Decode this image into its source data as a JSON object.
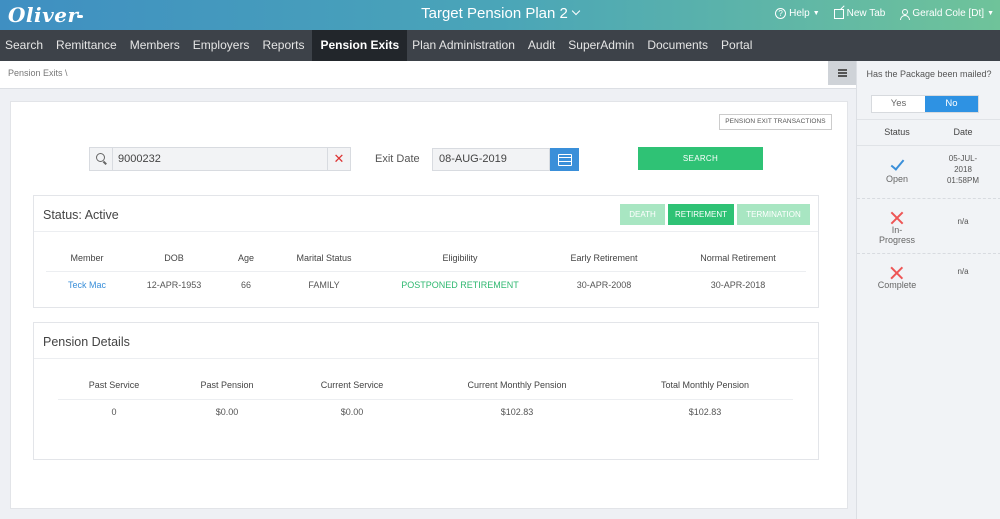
{
  "header": {
    "logo": "Oliver",
    "plan_title": "Target Pension Plan 2",
    "help": "Help",
    "new_tab": "New Tab",
    "user": "Gerald Cole [Dt]"
  },
  "nav": {
    "items": [
      "Search",
      "Remittance",
      "Members",
      "Employers",
      "Reports",
      "Pension Exits",
      "Plan Administration",
      "Audit",
      "SuperAdmin",
      "Documents",
      "Portal"
    ],
    "active": "Pension Exits"
  },
  "breadcrumb": "Pension Exits  \\",
  "main": {
    "transactions_button": "PENSION EXIT TRANSACTIONS",
    "search_value": "9000232",
    "exit_date_label": "Exit Date",
    "exit_date_value": "08-AUG-2019",
    "search_button": "SEARCH"
  },
  "status_card": {
    "title": "Status: Active",
    "buttons": {
      "death": "DEATH",
      "retirement": "RETIREMENT",
      "termination": "TERMINATION"
    },
    "columns": [
      "Member",
      "DOB",
      "Age",
      "Marital Status",
      "Eligibility",
      "Early Retirement",
      "Normal Retirement"
    ],
    "row": [
      "Teck Mac",
      "12-APR-1953",
      "66",
      "FAMILY",
      "POSTPONED RETIREMENT",
      "30-APR-2008",
      "30-APR-2018"
    ]
  },
  "pension_card": {
    "title": "Pension Details",
    "columns": [
      "Past Service",
      "Past Pension",
      "Current Service",
      "Current Monthly Pension",
      "Total Monthly Pension"
    ],
    "row": [
      "0",
      "$0.00",
      "$0.00",
      "$102.83",
      "$102.83"
    ]
  },
  "side_panel": {
    "question": "Has the Package been mailed?",
    "yes": "Yes",
    "no": "No",
    "selected": "No",
    "col_status": "Status",
    "col_date": "Date",
    "rows": [
      {
        "status": "Open",
        "icon": "check-icon",
        "date": "05-JUL-2018 01:58PM"
      },
      {
        "status": "In-Progress",
        "icon": "x-icon",
        "date": "n/a"
      },
      {
        "status": "Complete",
        "icon": "x-icon",
        "date": "n/a"
      }
    ]
  },
  "colors": {
    "accent_blue": "#3a8fd9",
    "accent_green": "#2fc275",
    "nav_bg": "#3d4249",
    "error_red": "#e55555"
  }
}
